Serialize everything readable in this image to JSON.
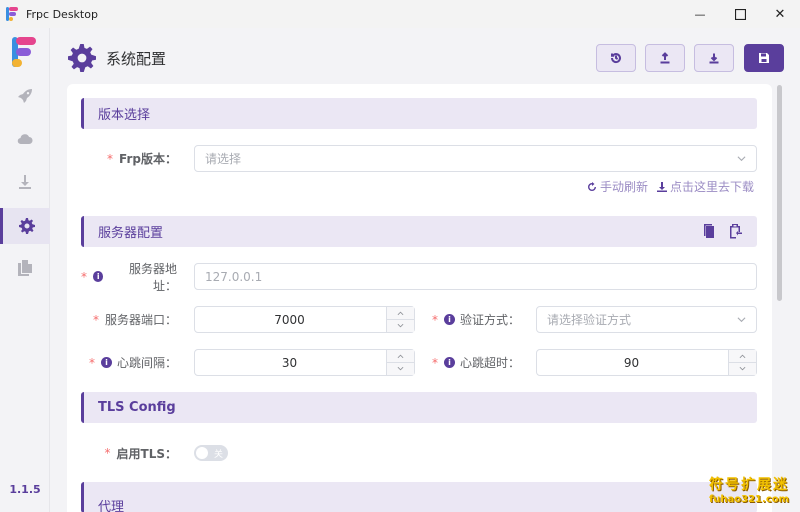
{
  "window": {
    "title": "Frpc Desktop",
    "minimize_glyph": "—",
    "close_glyph": "✕"
  },
  "sidebar": {
    "items": [
      {
        "icon": "rocket-icon"
      },
      {
        "icon": "cloud-icon"
      },
      {
        "icon": "download-icon"
      },
      {
        "icon": "gear-icon",
        "active": true
      },
      {
        "icon": "document-icon"
      }
    ],
    "version": "1.1.5"
  },
  "header": {
    "title": "系统配置",
    "buttons": [
      "history-icon",
      "upload-icon",
      "download-icon",
      "save-icon"
    ]
  },
  "version_section": {
    "title": "版本选择",
    "frp_label": "Frp版本：",
    "frp_placeholder": "请选择",
    "refresh_link": "手动刷新",
    "download_link": "点击这里去下载"
  },
  "server_section": {
    "title": "服务器配置",
    "address_label": "服务器地址：",
    "address_placeholder": "127.0.0.1",
    "port_label": "服务器端口：",
    "port_value": "7000",
    "auth_label": "验证方式：",
    "auth_placeholder": "请选择验证方式",
    "heartbeat_interval_label": "心跳间隔：",
    "heartbeat_interval_value": "30",
    "heartbeat_timeout_label": "心跳超时：",
    "heartbeat_timeout_value": "90"
  },
  "tls_section": {
    "title": "TLS Config",
    "enable_label": "启用TLS：",
    "switch_text": "关"
  },
  "proxy_section": {
    "title": "代理"
  },
  "watermark": {
    "line1": "符号扩展迷",
    "line2": "fuhao321.com"
  },
  "colors": {
    "accent": "#5a3e9c",
    "accent_light": "#ebe7f4",
    "required": "#f56c6c"
  }
}
